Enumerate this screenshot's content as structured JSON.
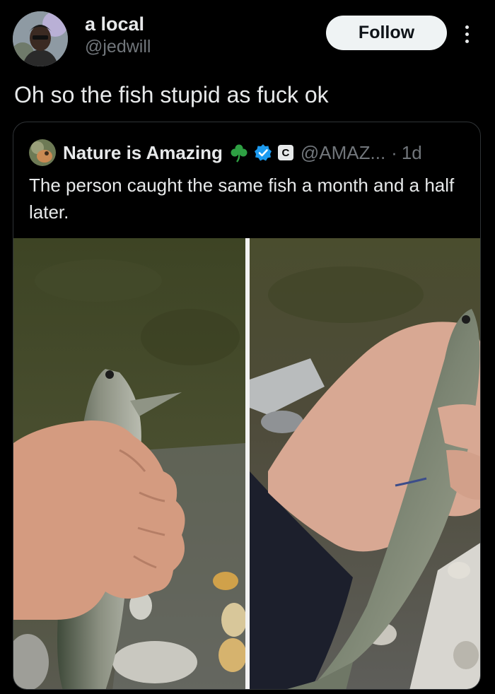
{
  "author": {
    "name": "a local",
    "handle": "@jedwill"
  },
  "follow_label": "Follow",
  "tweet": {
    "text": "Oh so the fish stupid as fuck ok"
  },
  "quoted": {
    "name": "Nature is Amazing",
    "handle": "@AMAZ...",
    "separator": "·",
    "time": "1d",
    "org_badge": "C",
    "text": "The person caught the same fish a month and a half later."
  },
  "colors": {
    "background": "#000000",
    "text": "#e7e9ea",
    "secondary_text": "#71767b",
    "verified": "#1d9bf0",
    "border": "#2f3336"
  },
  "icons": [
    "more-icon",
    "shamrock-icon",
    "verified-badge-icon",
    "org-badge-icon"
  ]
}
